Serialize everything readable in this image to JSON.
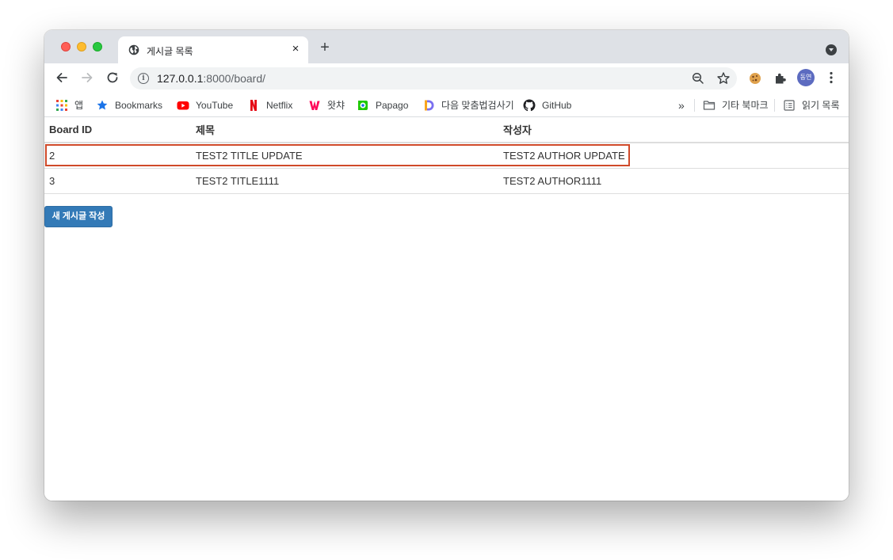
{
  "browser": {
    "tab": {
      "title": "게시글 목록",
      "close_glyph": "×",
      "favicon": "globe-icon"
    },
    "new_tab_glyph": "+",
    "address": {
      "host": "127.0.0.1",
      "rest": ":8000/board/"
    },
    "profile_initials": "동연",
    "bookmarks": [
      {
        "label": "앱",
        "icon": "apps-grid-icon"
      },
      {
        "label": "Bookmarks",
        "icon": "star-icon"
      },
      {
        "label": "YouTube",
        "icon": "youtube-icon"
      },
      {
        "label": "Netflix",
        "icon": "netflix-icon"
      },
      {
        "label": "왓챠",
        "icon": "watcha-icon"
      },
      {
        "label": "Papago",
        "icon": "papago-icon"
      },
      {
        "label": "다음 맞춤법검사기",
        "icon": "daum-icon"
      },
      {
        "label": "GitHub",
        "icon": "github-icon"
      }
    ],
    "overflow_glyph": "»",
    "other_bookmarks": "기타 북마크",
    "reading_list": "읽기 목록"
  },
  "board": {
    "headers": [
      "Board ID",
      "제목",
      "작성자"
    ],
    "rows": [
      {
        "id": "2",
        "title": "TEST2 TITLE UPDATE",
        "author": "TEST2 AUTHOR UPDATE",
        "highlighted": true
      },
      {
        "id": "3",
        "title": "TEST2 TITLE1111",
        "author": "TEST2 AUTHOR1111",
        "highlighted": false
      }
    ],
    "new_post_label": "새 게시글 작성"
  },
  "colors": {
    "highlight_border": "#d04a2a",
    "primary_button": "#337ab7",
    "tabstrip": "#dee1e6"
  }
}
